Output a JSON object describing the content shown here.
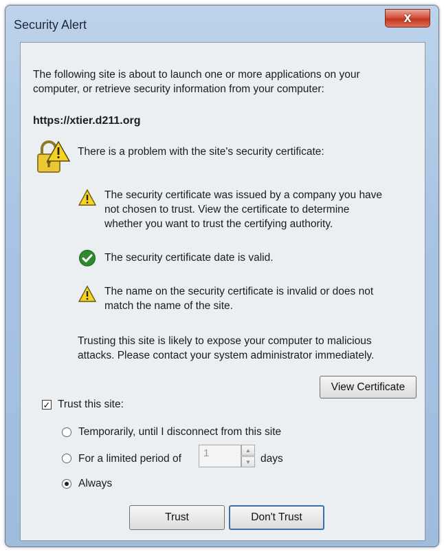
{
  "window": {
    "title": "Security Alert",
    "close_glyph": "x"
  },
  "intro": {
    "line1": "The following site is about to launch one or more applications on your",
    "line2": "computer, or retrieve security information from your computer:"
  },
  "site_url": "https://xtier.d211.org",
  "problem_heading": "There is a problem with the site's security certificate:",
  "issues": [
    {
      "icon": "warning-icon",
      "lines": [
        "The security certificate was issued by a company you have",
        "not chosen to trust. View the certificate to determine",
        "whether you want to trust the certifying authority."
      ]
    },
    {
      "icon": "check-icon",
      "lines": [
        "The security certificate date is valid."
      ]
    },
    {
      "icon": "warning-icon",
      "lines": [
        "The name on the security certificate is invalid or does not",
        "match the name of the site."
      ]
    }
  ],
  "advice": {
    "line1": "Trusting this site is likely to expose your computer to malicious",
    "line2": "attacks. Please contact your system administrator immediately."
  },
  "view_certificate_label": "View Certificate",
  "trust_site": {
    "label": "Trust this site:",
    "checked": true,
    "check_glyph": "✓"
  },
  "options": {
    "temporarily": "Temporarily, until I disconnect from this site",
    "limited_prefix": "For a limited period of",
    "limited_days_value": "1",
    "limited_suffix": "days",
    "always": "Always",
    "selected": "always"
  },
  "buttons": {
    "trust": "Trust",
    "dont_trust": "Don't Trust"
  },
  "colors": {
    "title_bar": "#a9c4e2",
    "close_red": "#c2361f",
    "client_bg": "#eceff2",
    "warning_yellow": "#f6d322",
    "check_green": "#2f8a2f"
  }
}
